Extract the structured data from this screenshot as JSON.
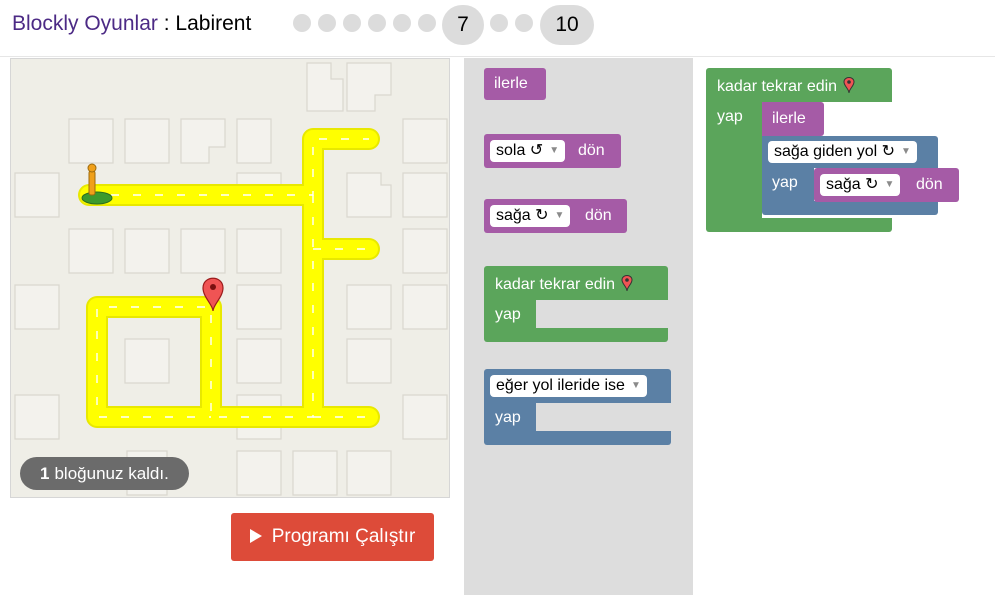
{
  "header": {
    "app_name": "Blockly Oyunlar",
    "separator": ":",
    "game_name": "Labirent",
    "levels": [
      "1",
      "2",
      "3",
      "4",
      "5",
      "6",
      "7",
      "8",
      "9",
      "10"
    ],
    "current_level": "7",
    "last_level": "10"
  },
  "maze": {
    "capacity_count": "1",
    "capacity_text": "bloğunuz kaldı."
  },
  "run_button": {
    "label": "Programı Çalıştır"
  },
  "toolbox": {
    "forward": "ilerle",
    "turn_left_dir": "sola ↺",
    "turn_left_suffix": "dön",
    "turn_right_dir": "sağa ↻",
    "turn_right_suffix": "dön",
    "repeat_label": "kadar tekrar edin",
    "repeat_do": "yap",
    "if_condition": "eğer yol ileride ise",
    "if_do": "yap"
  },
  "workspace": {
    "repeat_label": "kadar tekrar edin",
    "repeat_do": "yap",
    "forward": "ilerle",
    "if_condition": "sağa giden yol ↻",
    "if_do": "yap",
    "turn_dir": "sağa ↻",
    "turn_suffix": "dön"
  },
  "colors": {
    "title_purple": "#4c2a85",
    "motion_block": "#a55ba6",
    "loop_block": "#5ba55b",
    "logic_block": "#5b80a5",
    "run_button": "#dd4b39",
    "path": "#ffff00",
    "marker": "#f05454"
  }
}
